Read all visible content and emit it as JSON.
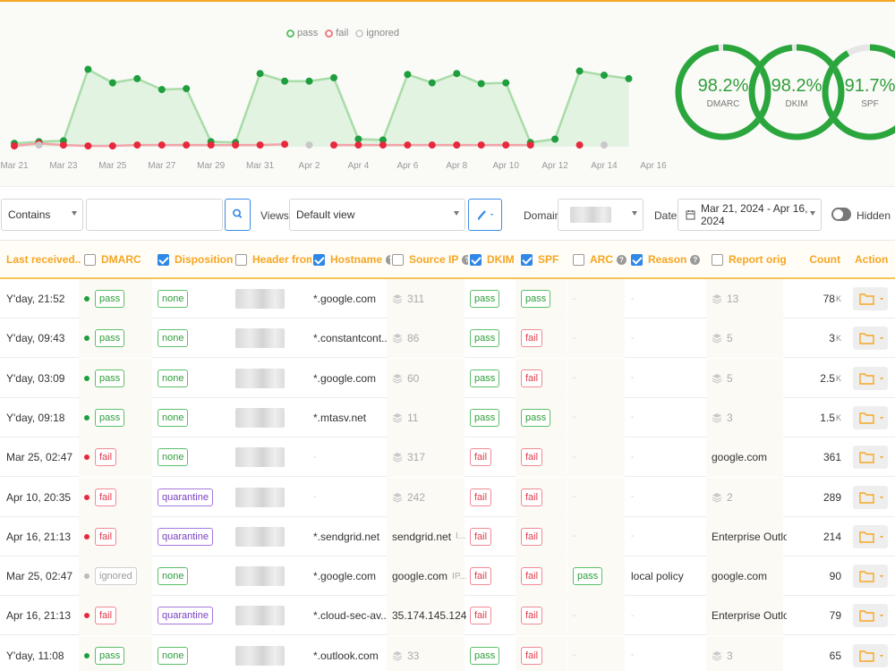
{
  "chart_data": {
    "type": "line",
    "categories": [
      "Mar 21",
      "Mar 22",
      "Mar 23",
      "Mar 24",
      "Mar 25",
      "Mar 26",
      "Mar 27",
      "Mar 28",
      "Mar 29",
      "Mar 30",
      "Mar 31",
      "Apr 1",
      "Apr 2",
      "Apr 3",
      "Apr 4",
      "Apr 5",
      "Apr 6",
      "Apr 7",
      "Apr 8",
      "Apr 9",
      "Apr 10",
      "Apr 11",
      "Apr 12",
      "Apr 13",
      "Apr 14",
      "Apr 15",
      "Apr 16"
    ],
    "tick_labels": [
      "Mar 21",
      "Mar 23",
      "Mar 25",
      "Mar 27",
      "Mar 29",
      "Mar 31",
      "Apr 2",
      "Apr 4",
      "Apr 6",
      "Apr 8",
      "Apr 10",
      "Apr 12",
      "Apr 14",
      "Apr 16"
    ],
    "series": [
      {
        "name": "pass",
        "color": "#1e9e3e",
        "values": [
          4,
          6,
          7,
          92,
          76,
          81,
          68,
          69,
          6,
          5,
          87,
          78,
          78,
          82,
          9,
          8,
          86,
          76,
          87,
          75,
          76,
          5,
          9,
          90,
          85,
          81,
          null
        ]
      },
      {
        "name": "fail",
        "color": "#e8283c",
        "values": [
          1,
          4,
          2,
          1,
          1,
          2,
          2,
          2,
          2,
          2,
          2,
          3,
          null,
          2,
          2,
          2,
          2,
          2,
          2,
          2,
          2,
          2,
          null,
          2,
          null,
          null,
          null
        ]
      },
      {
        "name": "ignored",
        "color": "#c8c8c8",
        "values": [
          null,
          2,
          null,
          null,
          null,
          null,
          null,
          null,
          null,
          null,
          null,
          null,
          2,
          null,
          null,
          null,
          null,
          null,
          null,
          null,
          null,
          null,
          null,
          null,
          2,
          null,
          null
        ]
      }
    ],
    "grid": false,
    "legend": "top-center"
  },
  "legend": [
    {
      "label": "pass",
      "color": "#5cc06a"
    },
    {
      "label": "fail",
      "color": "#f07a85"
    },
    {
      "label": "ignored",
      "color": "#cfcfcf"
    }
  ],
  "donuts": [
    {
      "value": "98.2%",
      "label": "DMARC",
      "fraction": 0.982
    },
    {
      "value": "98.2%",
      "label": "DKIM",
      "fraction": 0.982
    },
    {
      "value": "91.7%",
      "label": "SPF",
      "fraction": 0.917
    }
  ],
  "toolbar": {
    "filter_mode": "Contains",
    "search_value": "",
    "views_label": "Views",
    "view_selected": "Default view",
    "domain_label": "Domain",
    "date_label": "Date",
    "date_range": "Mar 21, 2024 - Apr 16, 2024",
    "hidden_label": "Hidden"
  },
  "columns": [
    {
      "label": "Last received...",
      "checkbox": null,
      "help": false
    },
    {
      "label": "DMARC",
      "checkbox": false,
      "help": false
    },
    {
      "label": "Disposition",
      "checkbox": true,
      "help": false
    },
    {
      "label": "Header from",
      "checkbox": false,
      "help": true
    },
    {
      "label": "Hostname",
      "checkbox": true,
      "help": true
    },
    {
      "label": "Source IP",
      "checkbox": false,
      "help": true
    },
    {
      "label": "DKIM",
      "checkbox": true,
      "help": false
    },
    {
      "label": "SPF",
      "checkbox": true,
      "help": false
    },
    {
      "label": "ARC",
      "checkbox": false,
      "help": true
    },
    {
      "label": "Reason",
      "checkbox": true,
      "help": true
    },
    {
      "label": "Report origin",
      "checkbox": false,
      "help": true
    },
    {
      "label": "Count",
      "checkbox": null,
      "help": false
    },
    {
      "label": "Action",
      "checkbox": null,
      "help": false
    }
  ],
  "rows": [
    {
      "last": "Y'day, 21:52",
      "dmarc": "pass",
      "disposition": "none",
      "hostname": "*.google.com",
      "source_ip": "311",
      "source_ip_stacked": true,
      "dkim": "pass",
      "spf": "pass",
      "arc": "-",
      "reason": "-",
      "origin": "13",
      "origin_stacked": true,
      "count": "78",
      "count_unit": "K"
    },
    {
      "last": "Y'day, 09:43",
      "dmarc": "pass",
      "disposition": "none",
      "hostname": "*.constantcont...",
      "source_ip": "86",
      "source_ip_stacked": true,
      "dkim": "pass",
      "spf": "fail",
      "arc": "-",
      "reason": "-",
      "origin": "5",
      "origin_stacked": true,
      "count": "3",
      "count_unit": "K"
    },
    {
      "last": "Y'day, 03:09",
      "dmarc": "pass",
      "disposition": "none",
      "hostname": "*.google.com",
      "source_ip": "60",
      "source_ip_stacked": true,
      "dkim": "pass",
      "spf": "fail",
      "arc": "-",
      "reason": "-",
      "origin": "5",
      "origin_stacked": true,
      "count": "2.5",
      "count_unit": "K"
    },
    {
      "last": "Y'day, 09:18",
      "dmarc": "pass",
      "disposition": "none",
      "hostname": "*.mtasv.net",
      "source_ip": "11",
      "source_ip_stacked": true,
      "dkim": "pass",
      "spf": "pass",
      "arc": "-",
      "reason": "-",
      "origin": "3",
      "origin_stacked": true,
      "count": "1.5",
      "count_unit": "K"
    },
    {
      "last": "Mar 25, 02:47",
      "dmarc": "fail",
      "disposition": "none",
      "hostname": "-",
      "source_ip": "317",
      "source_ip_stacked": true,
      "dkim": "fail",
      "spf": "fail",
      "arc": "-",
      "reason": "-",
      "origin": "google.com",
      "origin_stacked": false,
      "count": "361",
      "count_unit": ""
    },
    {
      "last": "Apr 10, 20:35",
      "dmarc": "fail",
      "disposition": "quarantine",
      "hostname": "-",
      "source_ip": "242",
      "source_ip_stacked": true,
      "dkim": "fail",
      "spf": "fail",
      "arc": "-",
      "reason": "-",
      "origin": "2",
      "origin_stacked": true,
      "count": "289",
      "count_unit": ""
    },
    {
      "last": "Apr 16, 21:13",
      "dmarc": "fail",
      "disposition": "quarantine",
      "hostname": "*.sendgrid.net",
      "source_ip": "sendgrid.net",
      "source_ip_suffix": "I...",
      "source_ip_stacked": false,
      "dkim": "fail",
      "spf": "fail",
      "arc": "-",
      "reason": "-",
      "origin": "Enterprise Outlook",
      "origin_stacked": false,
      "count": "214",
      "count_unit": ""
    },
    {
      "last": "Mar 25, 02:47",
      "dmarc": "ignored",
      "disposition": "none",
      "hostname": "*.google.com",
      "source_ip": "google.com",
      "source_ip_suffix": "IP...",
      "source_ip_stacked": false,
      "dkim": "fail",
      "spf": "fail",
      "arc": "pass",
      "reason": "local policy",
      "origin": "google.com",
      "origin_stacked": false,
      "count": "90",
      "count_unit": ""
    },
    {
      "last": "Apr 16, 21:13",
      "dmarc": "fail",
      "disposition": "quarantine",
      "hostname": "*.cloud-sec-av...",
      "source_ip": "35.174.145.124...",
      "source_ip_stacked": false,
      "dkim": "fail",
      "spf": "fail",
      "arc": "-",
      "reason": "-",
      "origin": "Enterprise Outlook",
      "origin_stacked": false,
      "count": "79",
      "count_unit": ""
    },
    {
      "last": "Y'day, 11:08",
      "dmarc": "pass",
      "disposition": "none",
      "hostname": "*.outlook.com",
      "source_ip": "33",
      "source_ip_stacked": true,
      "dkim": "pass",
      "spf": "fail",
      "arc": "-",
      "reason": "-",
      "origin": "3",
      "origin_stacked": true,
      "count": "65",
      "count_unit": ""
    }
  ]
}
